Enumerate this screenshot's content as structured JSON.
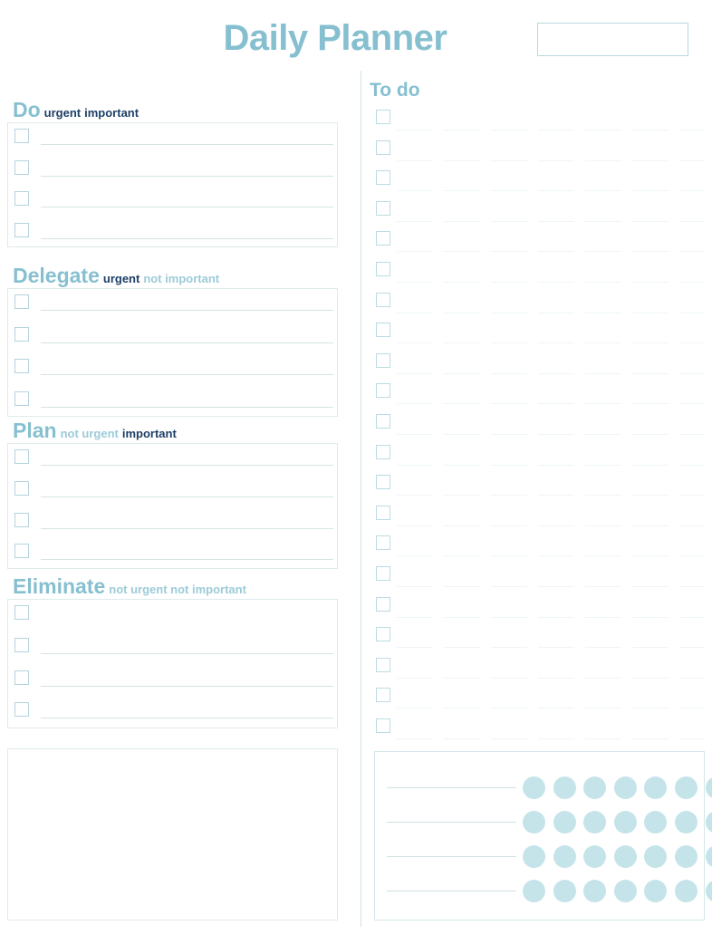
{
  "header": {
    "title": "Daily Planner",
    "date_box": {
      "value": "",
      "placeholder": ""
    }
  },
  "matrix": {
    "quadrants": [
      {
        "id": "do",
        "name": "Do",
        "tags": [
          {
            "text": "urgent",
            "emphasis": "dark"
          },
          {
            "text": "important",
            "emphasis": "dark"
          }
        ],
        "rows": [
          "",
          "",
          "",
          ""
        ]
      },
      {
        "id": "delegate",
        "name": "Delegate",
        "tags": [
          {
            "text": "urgent",
            "emphasis": "dark"
          },
          {
            "text": "not important",
            "emphasis": "light"
          }
        ],
        "rows": [
          "",
          "",
          "",
          ""
        ]
      },
      {
        "id": "plan",
        "name": "Plan",
        "tags": [
          {
            "text": "not urgent",
            "emphasis": "light"
          },
          {
            "text": "important",
            "emphasis": "dark"
          }
        ],
        "rows": [
          "",
          "",
          "",
          ""
        ]
      },
      {
        "id": "eliminate",
        "name": "Eliminate",
        "tags": [
          {
            "text": "not urgent not important",
            "emphasis": "light"
          }
        ],
        "rows": [
          "",
          "",
          "",
          ""
        ]
      }
    ]
  },
  "notes": {
    "value": ""
  },
  "todo": {
    "heading": "To do",
    "items": [
      "",
      "",
      "",
      "",
      "",
      "",
      "",
      "",
      "",
      "",
      "",
      "",
      "",
      "",
      "",
      "",
      "",
      "",
      "",
      "",
      ""
    ]
  },
  "tracker": {
    "rows": [
      {
        "label": "",
        "dots": 7
      },
      {
        "label": "",
        "dots": 7
      },
      {
        "label": "",
        "dots": 7
      },
      {
        "label": "",
        "dots": 7
      }
    ]
  },
  "colors": {
    "accent": "#86c0d0",
    "accent_dark": "#1d3f66",
    "accent_light": "#9ccbd8",
    "dot": "#c5e4ea",
    "border": "#dfeaea",
    "line": "#d4e4e4"
  }
}
